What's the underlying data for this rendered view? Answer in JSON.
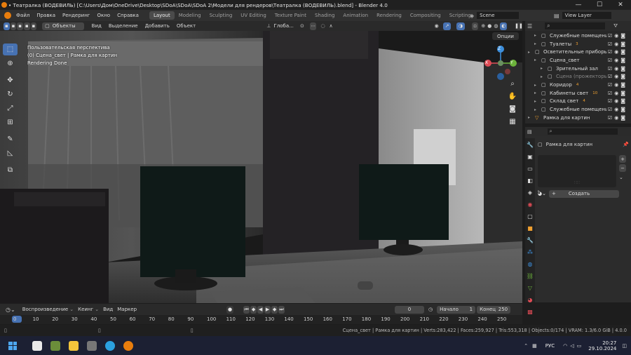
{
  "window": {
    "title": "• Театралка (ВОДЕВИЛЬ) [C:\\Users\\Дом\\OneDrive\\Desktop\\SDoA\\SDoA\\SDoA 2\\Модели для рендеров\\Театралка (ВОДЕВИЛЬ).blend] - Blender 4.0",
    "min": "—",
    "max": "☐",
    "close": "✕"
  },
  "menu": {
    "items": [
      "Файл",
      "Правка",
      "Рендеринг",
      "Окно",
      "Справка"
    ],
    "workspaces": [
      "Layout",
      "Modeling",
      "Sculpting",
      "UV Editing",
      "Texture Paint",
      "Shading",
      "Animation",
      "Rendering",
      "Compositing",
      "Scripting"
    ],
    "add_tab": "+",
    "scene": "Scene",
    "view_layer": "View Layer"
  },
  "viewport_header": {
    "mode": "Объекты",
    "menus": [
      "Вид",
      "Выделение",
      "Добавить",
      "Объект"
    ],
    "transform": "Глоба...",
    "options": "Опции"
  },
  "viewport": {
    "info_lines": [
      "Пользовательская перспектива",
      "(0) Сцена_свет | Рамка для картин",
      "Rendering Done"
    ],
    "gizmo": {
      "z": "Z",
      "y": "Y",
      "x": "X"
    }
  },
  "outliner": {
    "rows": [
      {
        "label": "Служебные помещения",
        "indent": 1,
        "badge": ""
      },
      {
        "label": "Туалеты",
        "indent": 1,
        "badge": "3"
      },
      {
        "label": "Осветительные приборы",
        "indent": 0,
        "badge": ""
      },
      {
        "label": "Сцена_свет",
        "indent": 1,
        "badge": ""
      },
      {
        "label": "Зрительный зал",
        "indent": 2,
        "badge": ""
      },
      {
        "label": "Сцена (прожекторы)",
        "indent": 2,
        "badge": ""
      },
      {
        "label": "Коридор",
        "indent": 1,
        "badge": "4"
      },
      {
        "label": "Кабинеты свет",
        "indent": 1,
        "badge": "10"
      },
      {
        "label": "Склад свет",
        "indent": 1,
        "badge": "4"
      },
      {
        "label": "Служебные помещения",
        "indent": 1,
        "badge": ""
      },
      {
        "label": "Рамка для картин",
        "indent": 0,
        "badge": ""
      }
    ]
  },
  "properties": {
    "object_name": "Рамка для картин",
    "create_button": "Создать",
    "add": "+",
    "remove": "−"
  },
  "timeline": {
    "playback": "Воспроизведение",
    "keying": "Кеинг",
    "view": "Вид",
    "marker": "Маркер",
    "current_frame": "0",
    "start_label": "Начало",
    "start": "1",
    "end_label": "Конец",
    "end": "250",
    "ruler": [
      "0",
      "10",
      "20",
      "30",
      "40",
      "50",
      "60",
      "70",
      "80",
      "90",
      "100",
      "110",
      "120",
      "130",
      "140",
      "150",
      "160",
      "170",
      "180",
      "190",
      "200",
      "210",
      "220",
      "230",
      "240",
      "250"
    ]
  },
  "statusbar": {
    "text": "Сцена_свет | Рамка для картин | Verts:283,422 | Faces:259,927 | Tris:553,318 | Objects:0/174 | VRAM: 1.3/6.0 GiB | 4.0.0"
  },
  "taskbar": {
    "lang": "РУС",
    "time": "20:27",
    "date": "29.10.2024"
  },
  "colors": {
    "accent": "#4772b3",
    "bg": "#1d1d1d",
    "gizmo_x": "#e04c56",
    "gizmo_y": "#6cb33b",
    "gizmo_z": "#3d8fdc"
  }
}
